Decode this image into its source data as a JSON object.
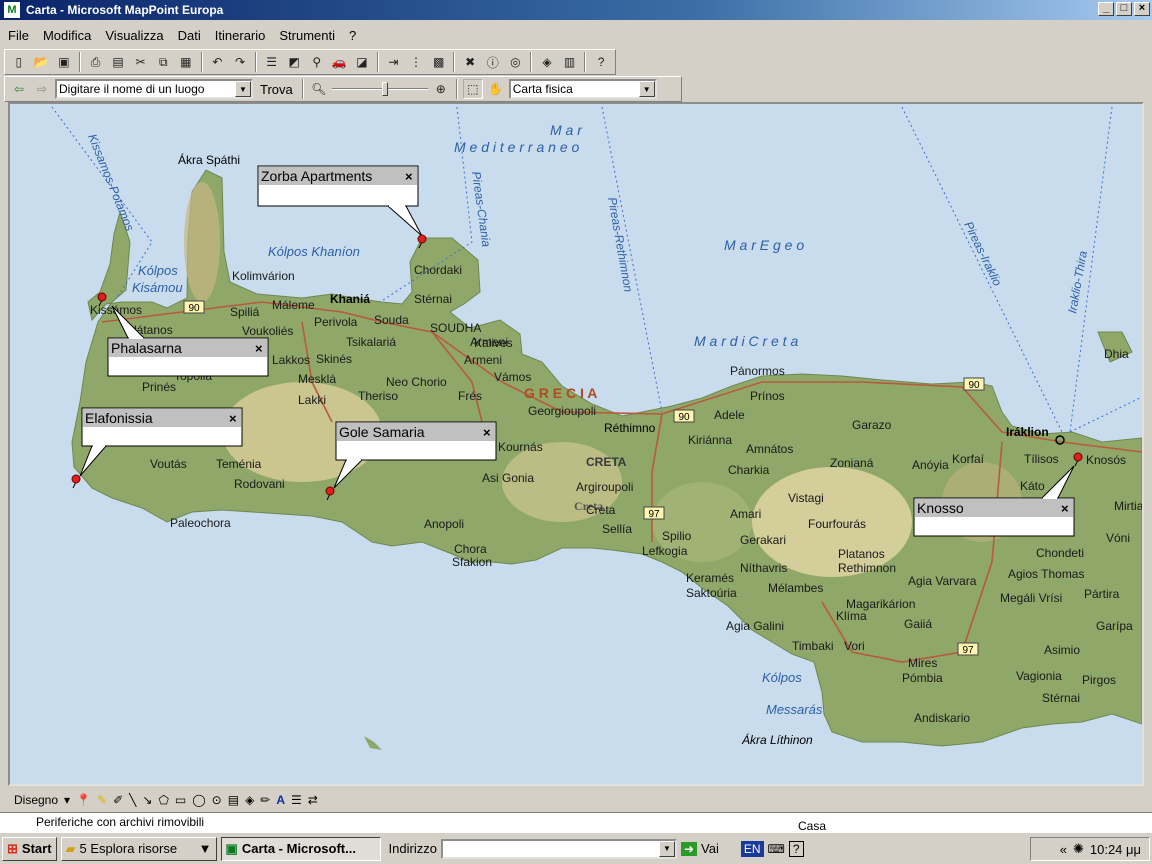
{
  "window": {
    "title": "Carta - Microsoft MapPoint Europa"
  },
  "menu": [
    "File",
    "Modifica",
    "Visualizza",
    "Dati",
    "Itinerario",
    "Strumenti",
    "?"
  ],
  "nav_bar": {
    "place_input": "Digitare il nome di un luogo",
    "find_label": "Trova",
    "map_style": "Carta fisica",
    "zoom_level": 0.56
  },
  "map": {
    "seas": [
      "M a r",
      "M e d i t e r r a n e o",
      "M a r   E g e o",
      "M a r   d i   C r e t a"
    ],
    "country": "G R E C I A",
    "region": "CRETA",
    "island": "Creta",
    "gulfs": [
      "Kólpos Khaníon",
      "Kólpos",
      "Kisámou",
      "Kólpos",
      "Messarás"
    ],
    "capes": [
      "Ákra Spáthi",
      "Ákra Líthinon"
    ],
    "ferry_routes": [
      "Kissamos-Potamos",
      "Pireas-Chania",
      "Pireas-Rethimnon",
      "Pireas-Iraklio",
      "Iraklio-Thira"
    ],
    "road_numbers": [
      "90",
      "90",
      "90",
      "97",
      "97"
    ],
    "cities": [
      "Khaniá",
      "Iráklion",
      "Réthimno"
    ],
    "places": [
      "Kolimvárion",
      "Máleme",
      "Spiliá",
      "Voukoliés",
      "Perivola",
      "Souda",
      "SOUDHA",
      "Chordaki",
      "Stérnai",
      "Kissámos",
      "Plátanos",
      "Tsikalariá",
      "Skinés",
      "Kalives",
      "Armeni",
      "Vámos",
      "Mesklá",
      "Neo Chorio",
      "Lakki",
      "Theriso",
      "Frés",
      "Georgioupoli",
      "Kournás",
      "Asi Gonia",
      "Argiroupoli",
      "Creta",
      "Sellía",
      "Spilio",
      "Lefkogia",
      "Anopoli",
      "Chora",
      "Sfakion",
      "Voutás",
      "Teménia",
      "Rodovani",
      "Paleochora",
      "Pánormos",
      "Prínos",
      "Adele",
      "Kiriánna",
      "Amnátos",
      "Charkia",
      "Garazo",
      "Zonianá",
      "Anóyia",
      "Tílisos",
      "Korfaí",
      "Káto",
      "Knosós",
      "Vistagi",
      "Amari",
      "Gerakari",
      "Fourfourás",
      "Platanos",
      "Rethimnon",
      "Níthavris",
      "Mélambes",
      "Keramés",
      "Saktoúria",
      "Klíma",
      "Agia Galini",
      "Timbaki",
      "Vori",
      "Magarikárion",
      "Agia Varvara",
      "Gaiiá",
      "Mires",
      "Pómbia",
      "Vagionia",
      "Andiskario",
      "Chondeti",
      "Agios Thomas",
      "Megáli Vrísi",
      "Pártira",
      "Garípa",
      "Asimio",
      "Pirgos",
      "Stérnai",
      "Vóni",
      "Mirtia",
      "Dhia",
      "Lakkos",
      "Topolia",
      "Prinés",
      "Armeni"
    ],
    "pushpins": [
      {
        "label": "Zorba Apartments",
        "note": ""
      },
      {
        "label": "Phalasarna",
        "note": ""
      },
      {
        "label": "Elafonissia",
        "note": ""
      },
      {
        "label": "Gole Samaria",
        "note": ""
      },
      {
        "label": "Knosso",
        "note": ""
      }
    ]
  },
  "draw_toolbar": {
    "label": "Disegno"
  },
  "background_window": {
    "item1": "Periferiche con archivi rimovibili",
    "item2": "Casa"
  },
  "taskbar": {
    "start": "Start",
    "task1": "5 Esplora risorse",
    "task2": "Carta - Microsoft...",
    "address_label": "Indirizzo",
    "go_label": "Vai",
    "lang": "EN",
    "clock": "10:24 μμ"
  },
  "colors": {
    "sea": "#c9dced",
    "land": "#8fa86a",
    "road": "#b85a3c",
    "route": "#3a6fd0",
    "pin": "#e02020"
  }
}
